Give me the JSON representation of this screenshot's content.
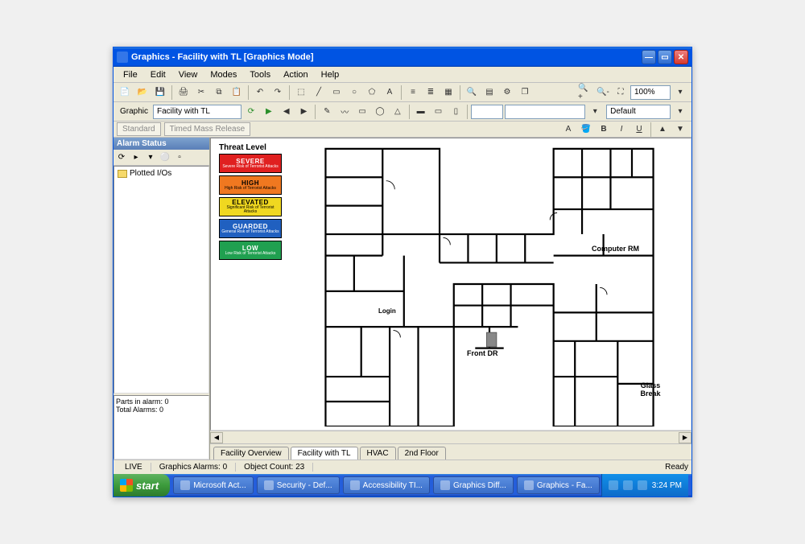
{
  "window": {
    "title": "Graphics - Facility with TL [Graphics Mode]"
  },
  "menu": {
    "items": [
      "File",
      "Edit",
      "View",
      "Modes",
      "Tools",
      "Action",
      "Help"
    ]
  },
  "toolbar1": {
    "zoom_value": "100%"
  },
  "toolbar2": {
    "graphic_label": "Graphic",
    "graphic_name": "Facility with TL",
    "alarm_filter": "Default"
  },
  "toolbar3": {
    "tab1": "Standard",
    "tab2": "Timed Mass Release"
  },
  "sidebar": {
    "header": "Alarm Status",
    "tree_root": "Plotted I/Os",
    "alarm_panel": {
      "line1": "Parts in alarm: 0",
      "line2": "Total Alarms: 0"
    }
  },
  "canvas": {
    "threat_title": "Threat Level",
    "threat_levels": [
      {
        "name": "SEVERE",
        "desc": "Severe Risk of Terrorist Attacks",
        "color": "#e02020",
        "text": "#ffffff"
      },
      {
        "name": "HIGH",
        "desc": "High Risk of Terrorist Attacks",
        "color": "#f07820",
        "text": "#000000"
      },
      {
        "name": "ELEVATED",
        "desc": "Significant Risk of Terrorist Attacks",
        "color": "#f0d820",
        "text": "#000000"
      },
      {
        "name": "GUARDED",
        "desc": "General Risk of Terrorist Attacks",
        "color": "#2060c0",
        "text": "#ffffff"
      },
      {
        "name": "LOW",
        "desc": "Low Risk of Terrorist Attacks",
        "color": "#20a050",
        "text": "#ffffff"
      }
    ],
    "labels": {
      "computer_rm": "Computer RM",
      "front_dr": "Front DR",
      "glass_break": "Glass Break",
      "login": "Login"
    }
  },
  "tabs": {
    "items": [
      "Facility Overview",
      "Facility with TL",
      "HVAC",
      "2nd Floor"
    ],
    "active_index": 1
  },
  "statusbar": {
    "mode": "LIVE",
    "alarms": "Graphics Alarms: 0",
    "objects": "Object Count: 23",
    "ready": "Ready"
  },
  "taskbar": {
    "start": "start",
    "items": [
      "Microsoft Act...",
      "Security - Def...",
      "Accessibility TI...",
      "Graphics Diff...",
      "Graphics - Fa..."
    ],
    "clock": "3:24 PM"
  }
}
